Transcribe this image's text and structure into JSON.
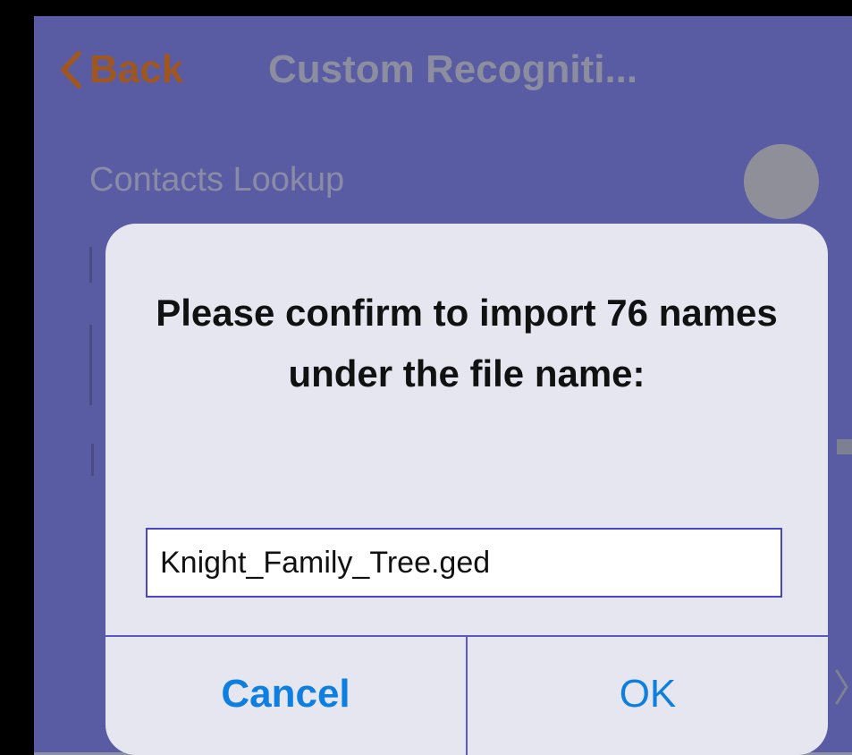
{
  "nav": {
    "back_label": "Back",
    "title": "Custom Recogniti..."
  },
  "settings": {
    "contacts_lookup_label": "Contacts Lookup"
  },
  "dialog": {
    "title": "Please confirm to import 76 names under the file name:",
    "filename_value": "Knight_Family_Tree.ged",
    "cancel_label": "Cancel",
    "ok_label": "OK"
  },
  "colors": {
    "background": "#595ba3",
    "back_accent": "#a0571f",
    "dialog_button": "#0d7fe0"
  },
  "icons": {
    "back": "chevron-left-icon",
    "row_disclosure": "chevron-right-icon"
  }
}
